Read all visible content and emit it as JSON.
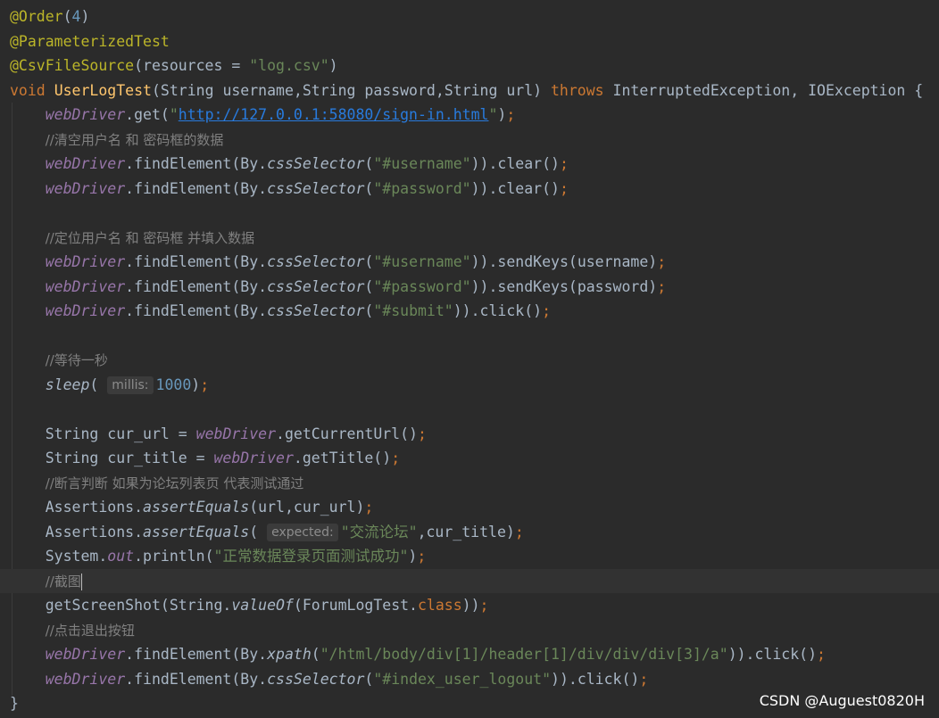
{
  "code": {
    "l1_annotation": "@Order",
    "l1_num": "4",
    "l2_annotation": "@ParameterizedTest",
    "l3_annotation": "@CsvFileSource",
    "l3_param": "resources = ",
    "l3_string": "\"log.csv\"",
    "l4_void": "void",
    "l4_method": "UserLogTest",
    "l4_params": "(String username,String password,String url) ",
    "l4_throws": "throws",
    "l4_exceptions": " InterruptedException, IOException {",
    "webdriver": "webDriver",
    "get": ".get(",
    "url_quote_open": "\"",
    "url": "http://127.0.0.1:58080/sign-in.html",
    "url_quote_close": "\"",
    "close_paren_semi": ");",
    "comment_clear": "//清空用户名 和 密码框的数据",
    "find_element_by": ".findElement(By.",
    "css_selector": "cssSelector",
    "xpath": "xpath",
    "sel_username": "\"#username\"",
    "sel_password": "\"#password\"",
    "sel_submit": "\"#submit\"",
    "sel_logout": "\"#index_user_logout\"",
    "sel_xpath": "\"/html/body/div[1]/header[1]/div/div/div[3]/a\"",
    "clear_call": ")).clear()",
    "send_keys_username": ")).sendKeys(username)",
    "send_keys_password": ")).sendKeys(password)",
    "click_call": ")).click()",
    "semi": ";",
    "comment_fill": "//定位用户名 和 密码框 并填入数据",
    "comment_wait": "//等待一秒",
    "sleep": "sleep",
    "open_paren": "(",
    "hint_millis": "millis:",
    "sleep_value": "1000",
    "string_cur_url": "String cur_url = ",
    "get_current_url": ".getCurrentUrl()",
    "string_cur_title": "String cur_title = ",
    "get_title": ".getTitle()",
    "comment_assert": "//断言判断 如果为论坛列表页 代表测试通过",
    "assertions": "Assertions.",
    "assert_equals": "assertEquals",
    "assert_args_1": "(url,cur_url)",
    "hint_expected": "expected:",
    "expected_value": "\"交流论坛\"",
    "assert_args_2_tail": ",cur_title)",
    "system": "System.",
    "out": "out",
    "println": ".println(",
    "println_value": "\"正常数据登录页面测试成功\"",
    "println_close": ")",
    "comment_screenshot": "//截图",
    "get_screenshot": "getScreenShot(String.",
    "value_of": "valueOf",
    "forum_log_test": "(ForumLogTest.",
    "class_kw": "class",
    "screenshot_close": "))",
    "comment_logout": "//点击退出按钮",
    "closing_brace": "}"
  },
  "watermark": "CSDN @Auguest0820H"
}
